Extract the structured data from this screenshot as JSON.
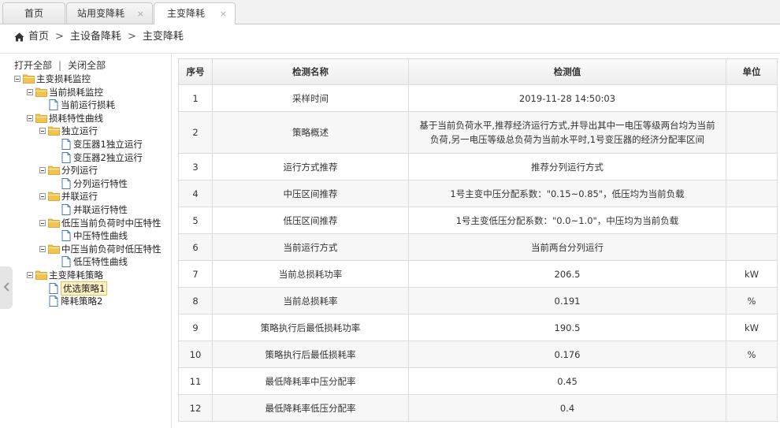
{
  "tabs": [
    {
      "label": "首页",
      "closable": false,
      "active": false
    },
    {
      "label": "站用变降耗",
      "closable": true,
      "active": false
    },
    {
      "label": "主变降耗",
      "closable": true,
      "active": true
    }
  ],
  "close_glyph": "×",
  "breadcrumb": {
    "items": [
      "首页",
      "主设备降耗",
      "主变降耗"
    ],
    "separator": ">"
  },
  "tree_actions": {
    "open_all": "打开全部",
    "divider": "|",
    "close_all": "关闭全部"
  },
  "tree": [
    {
      "label": "主变损耗监控",
      "type": "folder",
      "level": 0
    },
    {
      "label": "当前损耗监控",
      "type": "folder",
      "level": 1
    },
    {
      "label": "当前运行损耗",
      "type": "file",
      "level": 2
    },
    {
      "label": "损耗特性曲线",
      "type": "folder",
      "level": 1
    },
    {
      "label": "独立运行",
      "type": "folder",
      "level": 2
    },
    {
      "label": "变压器1独立运行",
      "type": "file",
      "level": 3
    },
    {
      "label": "变压器2独立运行",
      "type": "file",
      "level": 3
    },
    {
      "label": "分列运行",
      "type": "folder",
      "level": 2
    },
    {
      "label": "分列运行特性",
      "type": "file",
      "level": 3
    },
    {
      "label": "并联运行",
      "type": "folder",
      "level": 2
    },
    {
      "label": "并联运行特性",
      "type": "file",
      "level": 3
    },
    {
      "label": "低压当前负荷时中压特性",
      "type": "folder",
      "level": 2
    },
    {
      "label": "中压特性曲线",
      "type": "file",
      "level": 3
    },
    {
      "label": "中压当前负荷时低压特性",
      "type": "folder",
      "level": 2
    },
    {
      "label": "低压特性曲线",
      "type": "file",
      "level": 3
    },
    {
      "label": "主变降耗策略",
      "type": "folder",
      "level": 1
    },
    {
      "label": "优选策略1",
      "type": "file",
      "level": 2,
      "selected": true
    },
    {
      "label": "降耗策略2",
      "type": "file",
      "level": 2
    }
  ],
  "table": {
    "headers": [
      "序号",
      "检测名称",
      "检测值",
      "单位"
    ],
    "rows": [
      {
        "no": "1",
        "name": "采样时间",
        "value": "2019-11-28 14:50:03",
        "unit": ""
      },
      {
        "no": "2",
        "name": "策略概述",
        "value": "基于当前负荷水平,推荐经济运行方式,并导出其中一电压等级两台均为当前负荷,另一电压等级总负荷为当前水平时,1号变压器的经济分配率区间",
        "unit": ""
      },
      {
        "no": "3",
        "name": "运行方式推荐",
        "value": "推荐分列运行方式",
        "unit": ""
      },
      {
        "no": "4",
        "name": "中压区间推荐",
        "value": "1号主变中压分配系数：\"0.15~0.85\"，低压均为当前负载",
        "unit": ""
      },
      {
        "no": "5",
        "name": "低压区间推荐",
        "value": "1号主变低压分配系数：\"0.0~1.0\"，中压均为当前负载",
        "unit": ""
      },
      {
        "no": "6",
        "name": "当前运行方式",
        "value": "当前两台分列运行",
        "unit": ""
      },
      {
        "no": "7",
        "name": "当前总损耗功率",
        "value": "206.5",
        "unit": "kW"
      },
      {
        "no": "8",
        "name": "当前总损耗率",
        "value": "0.191",
        "unit": "%"
      },
      {
        "no": "9",
        "name": "策略执行后最低损耗功率",
        "value": "190.5",
        "unit": "kW"
      },
      {
        "no": "10",
        "name": "策略执行后最低损耗率",
        "value": "0.176",
        "unit": "%"
      },
      {
        "no": "11",
        "name": "最低降耗率中压分配率",
        "value": "0.45",
        "unit": ""
      },
      {
        "no": "12",
        "name": "最低降耗率低压分配率",
        "value": "0.4",
        "unit": ""
      }
    ]
  },
  "colors": {
    "folder": "#f5c24c",
    "file": "#4a78b8",
    "selected_bg": "#fff1c4",
    "border": "#dcdcdc"
  }
}
